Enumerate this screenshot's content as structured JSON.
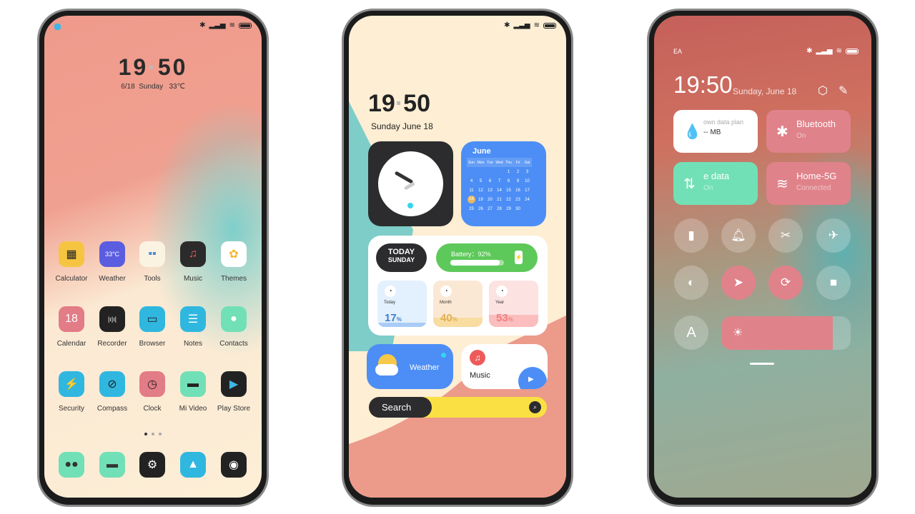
{
  "home": {
    "time_h": "19",
    "time_m": "50",
    "date": "6/18  Sunday   33℃",
    "apps": [
      {
        "label": "Calculator",
        "icon": "calculator-icon",
        "glyph": "▦",
        "bg": "#f5c542",
        "fg": "#222"
      },
      {
        "label": "Weather",
        "icon": "weather-icon",
        "glyph": "33°C",
        "bg": "#5b5de0",
        "fg": "#fff"
      },
      {
        "label": "Tools",
        "icon": "tools-folder-icon",
        "glyph": "▪▪",
        "bg": "#fbf3e2",
        "fg": "#4a8ad8"
      },
      {
        "label": "Music",
        "icon": "music-icon",
        "glyph": "♫",
        "bg": "#2b2b2b",
        "fg": "#ee5a5a"
      },
      {
        "label": "Themes",
        "icon": "themes-icon",
        "glyph": "✿",
        "bg": "#ffffff",
        "fg": "#f2b630"
      },
      {
        "label": "Calendar",
        "icon": "calendar-icon",
        "glyph": "18",
        "bg": "#e27c86",
        "fg": "#fff"
      },
      {
        "label": "Recorder",
        "icon": "recorder-icon",
        "glyph": "|ı|ı|",
        "bg": "#222",
        "fg": "#fff"
      },
      {
        "label": "Browser",
        "icon": "browser-icon",
        "glyph": "▭",
        "bg": "#2fb7e0",
        "fg": "#222"
      },
      {
        "label": "Notes",
        "icon": "notes-icon",
        "glyph": "☰",
        "bg": "#2fb7e0",
        "fg": "#fff"
      },
      {
        "label": "Contacts",
        "icon": "contacts-icon",
        "glyph": "●",
        "bg": "#72e0b6",
        "fg": "#fff"
      },
      {
        "label": "Security",
        "icon": "security-shield-icon",
        "glyph": "⚡",
        "bg": "#2fb7e0",
        "fg": "#fff"
      },
      {
        "label": "Compass",
        "icon": "compass-icon",
        "glyph": "⊘",
        "bg": "#2fb7e0",
        "fg": "#222"
      },
      {
        "label": "Clock",
        "icon": "clock-icon",
        "glyph": "◷",
        "bg": "#e27c86",
        "fg": "#222"
      },
      {
        "label": "Mi Video",
        "icon": "video-clapper-icon",
        "glyph": "▬",
        "bg": "#72e0b6",
        "fg": "#222"
      },
      {
        "label": "Play Store",
        "icon": "play-store-icon",
        "glyph": "▶",
        "bg": "#222",
        "fg": "#3fb6e6"
      }
    ],
    "dock": [
      {
        "icon": "phone-dialer-icon",
        "glyph": "●●",
        "bg": "#72e0b6",
        "fg": "#333"
      },
      {
        "icon": "messages-icon",
        "glyph": "▬",
        "bg": "#72e0b6",
        "fg": "#333"
      },
      {
        "icon": "settings-gear-icon",
        "glyph": "⚙",
        "bg": "#222",
        "fg": "#fff"
      },
      {
        "icon": "gallery-icon",
        "glyph": "▲",
        "bg": "#2fb7e0",
        "fg": "#fff"
      },
      {
        "icon": "camera-icon",
        "glyph": "◉",
        "bg": "#222",
        "fg": "#fff"
      }
    ]
  },
  "widgets": {
    "time_h": "19",
    "time_m": "50",
    "date": "Sunday June 18",
    "calendar": {
      "month": "June",
      "weekdays": [
        "Sun",
        "Mon",
        "Tue",
        "Wed",
        "Thu",
        "Fri",
        "Sat"
      ],
      "weeks": [
        [
          "",
          "",
          "",
          "",
          "1",
          "2",
          "3"
        ],
        [
          "4",
          "5",
          "6",
          "7",
          "8",
          "9",
          "10"
        ],
        [
          "11",
          "12",
          "13",
          "14",
          "15",
          "16",
          "17"
        ],
        [
          "18",
          "19",
          "20",
          "21",
          "22",
          "23",
          "24"
        ],
        [
          "25",
          "26",
          "27",
          "28",
          "29",
          "30",
          ""
        ]
      ],
      "today": "18"
    },
    "today_line1": "TODAY",
    "today_line2": "SUNDAY",
    "battery_label": "Battery：92%",
    "battery_percent": 92,
    "progress": [
      {
        "label": "Today",
        "value": "17",
        "unit": "%",
        "percent": 17,
        "bg": "#e3f0fd",
        "fill": "#a9ccf6",
        "fg": "#3d7fd0",
        "icon": "timer-icon"
      },
      {
        "label": "Month",
        "value": "40",
        "unit": "%",
        "percent": 40,
        "bg": "#fbe8d4",
        "fill": "#f8dca0",
        "fg": "#e0b050",
        "icon": "toggle-icon"
      },
      {
        "label": "Year",
        "value": "53",
        "unit": "%",
        "percent": 53,
        "bg": "#fde2e2",
        "fill": "#fbbdbd",
        "fg": "#f08080",
        "icon": "hourglass-icon"
      }
    ],
    "weather_label": "Weather",
    "music_label": "Music",
    "search_label": "Search"
  },
  "control": {
    "carrier": "EA",
    "time": "19:50",
    "date": "Sunday, June 18",
    "tiles": [
      {
        "title": "own data plan",
        "sub": "-- MB",
        "icon": "water-drop-icon",
        "glyph": "💧",
        "bg": "#ffffff"
      },
      {
        "title": "Bluetooth",
        "sub": "On",
        "icon": "bluetooth-icon",
        "glyph": "✱",
        "bg": "#e0828a"
      },
      {
        "title": "e data",
        "sub": "On",
        "icon": "mobile-data-icon",
        "glyph": "⇅",
        "bg": "#72e0b6"
      },
      {
        "title": "Home-5G",
        "sub": "Connected",
        "icon": "wifi-icon",
        "glyph": "≋",
        "bg": "#e0828a"
      }
    ],
    "toggles": [
      {
        "icon": "flashlight-icon",
        "glyph": "▮",
        "on": false
      },
      {
        "icon": "bell-icon",
        "glyph": "🔔︎",
        "on": false
      },
      {
        "icon": "screenshot-icon",
        "glyph": "✂",
        "on": false
      },
      {
        "icon": "airplane-icon",
        "glyph": "✈",
        "on": false
      },
      {
        "icon": "dark-mode-icon",
        "glyph": "◐",
        "on": false
      },
      {
        "icon": "location-icon",
        "glyph": "➤",
        "on": true
      },
      {
        "icon": "rotation-lock-icon",
        "glyph": "⟳",
        "on": true
      },
      {
        "icon": "video-camera-icon",
        "glyph": "■",
        "on": false
      }
    ],
    "auto_brightness_label": "A",
    "brightness_percent": 86,
    "accent": "#e0828a"
  }
}
